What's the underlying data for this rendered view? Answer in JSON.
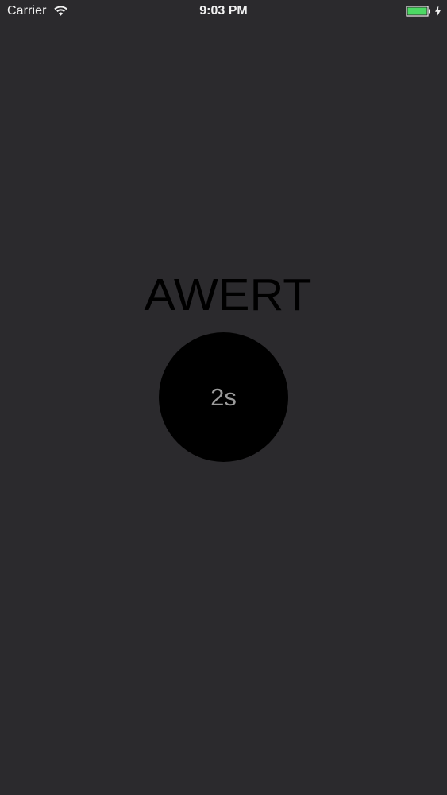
{
  "status_bar": {
    "carrier": "Carrier",
    "time": "9:03 PM",
    "wifi_icon": "wifi-icon",
    "battery_icon": "battery-icon",
    "charging_icon": "charging-bolt-icon",
    "battery_color": "#4cd964"
  },
  "logo": {
    "text": "AWERT",
    "color": "#000000"
  },
  "timer": {
    "label": "2s",
    "background": "#000000",
    "text_color": "#9b9b9b"
  },
  "colors": {
    "background": "#2b2a2d",
    "status_text": "#f1f1f1"
  }
}
